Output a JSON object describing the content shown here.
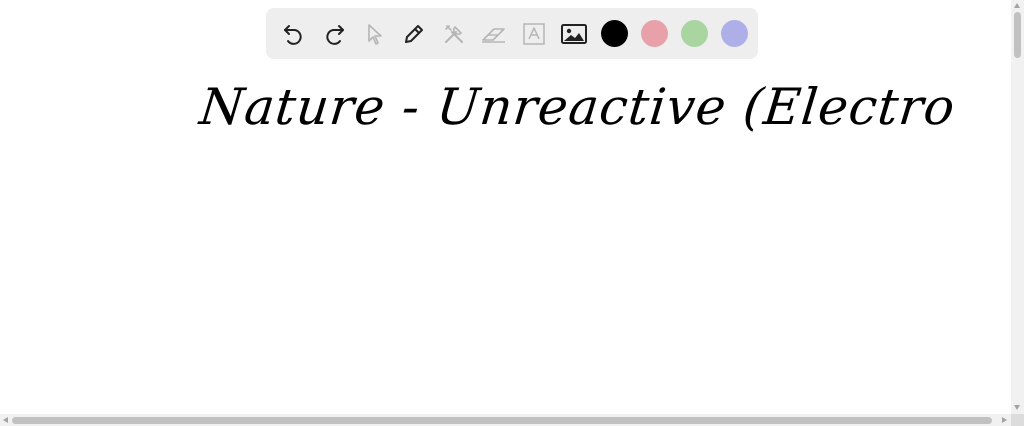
{
  "toolbar": {
    "tools": [
      {
        "name": "undo-icon",
        "enabled": true
      },
      {
        "name": "redo-icon",
        "enabled": true
      },
      {
        "name": "select-pointer-icon",
        "enabled": false
      },
      {
        "name": "pen-icon",
        "enabled": true
      },
      {
        "name": "tools-icon",
        "enabled": false
      },
      {
        "name": "eraser-icon",
        "enabled": false
      },
      {
        "name": "text-icon",
        "enabled": false
      },
      {
        "name": "image-icon",
        "enabled": true
      }
    ],
    "colors": [
      "#000000",
      "#e8a1a8",
      "#a8d5a0",
      "#aeaee8"
    ],
    "selected_color": "#000000"
  },
  "canvas": {
    "handwriting": "Nature - Unreactive (Electro"
  }
}
